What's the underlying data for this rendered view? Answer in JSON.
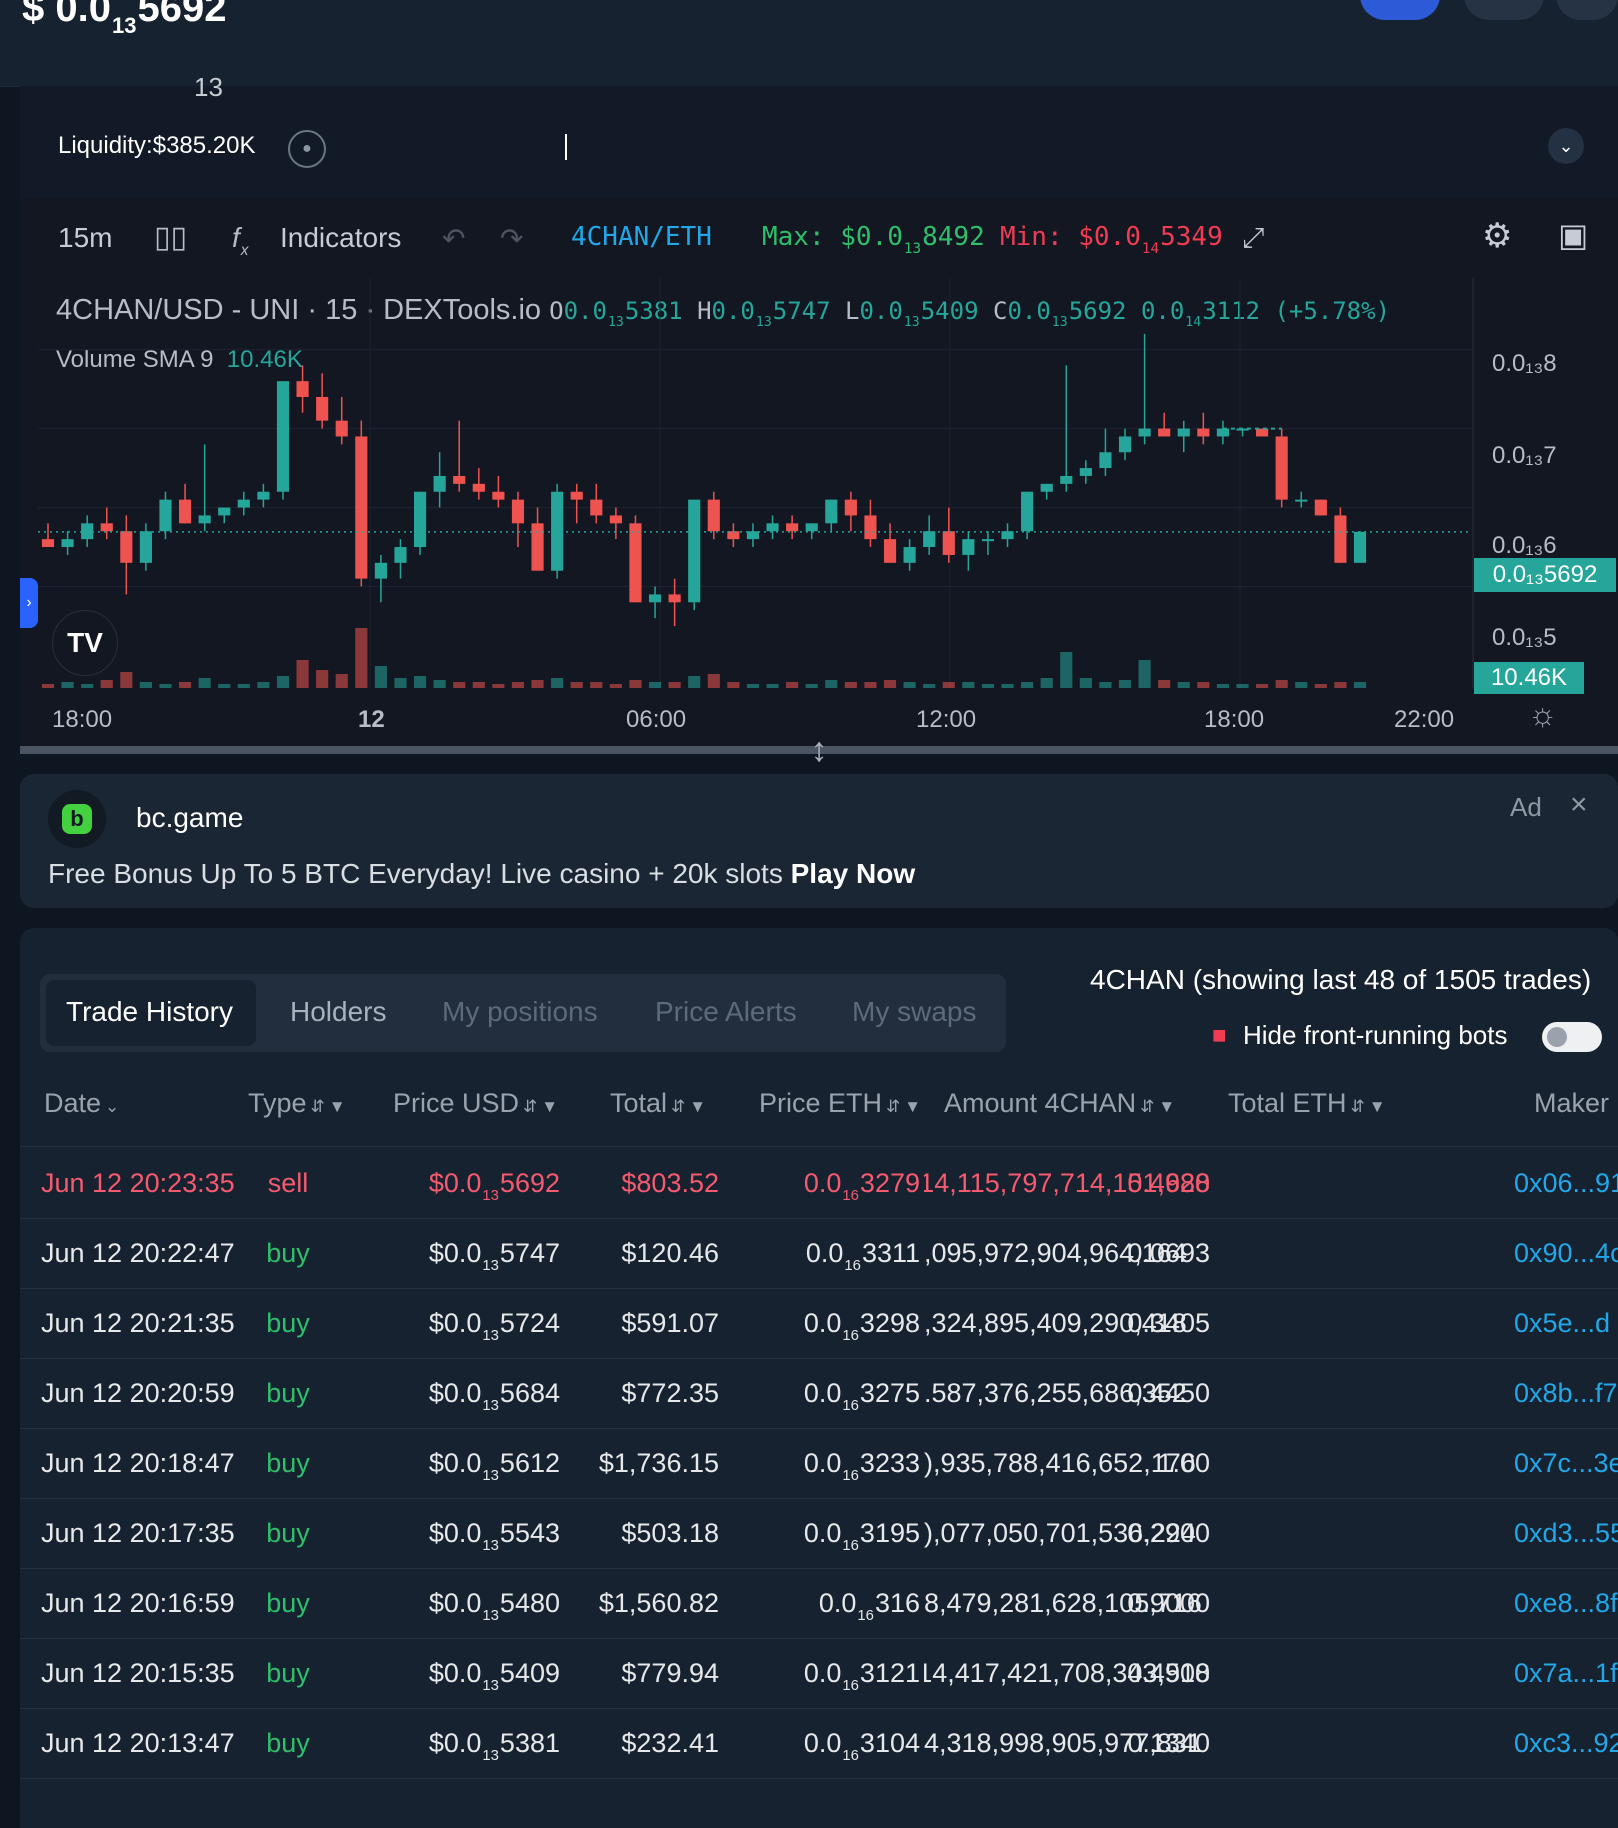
{
  "header": {
    "price_prefix": "$ 0.0",
    "price_sub": "13",
    "price_digits": "5692",
    "stray_sub": "13",
    "liquidity_label": "Liquidity:",
    "liquidity_value": "$385.20K"
  },
  "toolbar": {
    "interval": "15m",
    "indicators_label": "Indicators",
    "pair": "4CHAN/ETH",
    "max_label": "Max: $0.0",
    "max_sub": "13",
    "max_digits": "8492",
    "min_label": "Min: $0.0",
    "min_sub": "14",
    "min_digits": "5349"
  },
  "legend": {
    "symbol": "4CHAN/USD - UNI · 15 · DEXTools.io",
    "o_label": "O",
    "o_prefix": "0.0",
    "o_sub": "13",
    "o_digits": "5381",
    "h_label": "H",
    "h_prefix": "0.0",
    "h_sub": "13",
    "h_digits": "5747",
    "l_label": "L",
    "l_prefix": "0.0",
    "l_sub": "13",
    "l_digits": "5409",
    "c_label": "C",
    "c_prefix": "0.0",
    "c_sub": "13",
    "c_digits": "5692",
    "chg_prefix": "0.0",
    "chg_sub": "14",
    "chg_digits": "3112",
    "chg_pct": "(+5.78%)",
    "volume_label": "Volume SMA 9",
    "volume_value": "10.46K"
  },
  "chart_data": {
    "type": "candlestick",
    "title": "4CHAN/USD - UNI · 15 · DEXTools.io",
    "y_ticks": [
      "0.0₁₃8",
      "0.0₁₃7",
      "0.0₁₃6",
      "0.0₁₃5"
    ],
    "current_price_label": "0.0₁₃5692",
    "volume_label": "10.46K",
    "x_ticks": [
      "18:00",
      "12",
      "06:00",
      "12:00",
      "18:00",
      "22:00"
    ],
    "ylim": [
      0.45,
      0.84
    ],
    "y_unit": "×1e-13 USD",
    "current_price": 0.5692,
    "candles": [
      [
        0.56,
        0.58,
        0.55,
        0.55
      ],
      [
        0.55,
        0.57,
        0.54,
        0.56
      ],
      [
        0.56,
        0.59,
        0.55,
        0.58
      ],
      [
        0.58,
        0.6,
        0.56,
        0.57
      ],
      [
        0.57,
        0.59,
        0.49,
        0.53
      ],
      [
        0.53,
        0.58,
        0.52,
        0.57
      ],
      [
        0.57,
        0.62,
        0.56,
        0.61
      ],
      [
        0.61,
        0.63,
        0.58,
        0.58
      ],
      [
        0.58,
        0.68,
        0.57,
        0.59
      ],
      [
        0.59,
        0.6,
        0.58,
        0.6
      ],
      [
        0.6,
        0.62,
        0.59,
        0.61
      ],
      [
        0.61,
        0.63,
        0.6,
        0.62
      ],
      [
        0.62,
        0.76,
        0.61,
        0.76
      ],
      [
        0.76,
        0.78,
        0.72,
        0.74
      ],
      [
        0.74,
        0.77,
        0.7,
        0.71
      ],
      [
        0.71,
        0.74,
        0.68,
        0.69
      ],
      [
        0.69,
        0.71,
        0.5,
        0.51
      ],
      [
        0.51,
        0.54,
        0.48,
        0.53
      ],
      [
        0.53,
        0.56,
        0.51,
        0.55
      ],
      [
        0.55,
        0.62,
        0.54,
        0.62
      ],
      [
        0.62,
        0.67,
        0.6,
        0.64
      ],
      [
        0.64,
        0.71,
        0.62,
        0.63
      ],
      [
        0.63,
        0.65,
        0.61,
        0.62
      ],
      [
        0.62,
        0.64,
        0.6,
        0.61
      ],
      [
        0.61,
        0.62,
        0.55,
        0.58
      ],
      [
        0.58,
        0.6,
        0.54,
        0.52
      ],
      [
        0.52,
        0.63,
        0.51,
        0.62
      ],
      [
        0.62,
        0.63,
        0.58,
        0.61
      ],
      [
        0.61,
        0.63,
        0.58,
        0.59
      ],
      [
        0.59,
        0.6,
        0.56,
        0.58
      ],
      [
        0.58,
        0.59,
        0.52,
        0.48
      ],
      [
        0.48,
        0.5,
        0.46,
        0.49
      ],
      [
        0.49,
        0.51,
        0.45,
        0.48
      ],
      [
        0.48,
        0.6,
        0.47,
        0.61
      ],
      [
        0.61,
        0.62,
        0.56,
        0.57
      ],
      [
        0.57,
        0.58,
        0.55,
        0.56
      ],
      [
        0.56,
        0.58,
        0.55,
        0.57
      ],
      [
        0.57,
        0.59,
        0.56,
        0.58
      ],
      [
        0.58,
        0.59,
        0.56,
        0.57
      ],
      [
        0.57,
        0.58,
        0.56,
        0.58
      ],
      [
        0.58,
        0.61,
        0.57,
        0.61
      ],
      [
        0.61,
        0.62,
        0.57,
        0.59
      ],
      [
        0.59,
        0.61,
        0.55,
        0.56
      ],
      [
        0.56,
        0.58,
        0.54,
        0.53
      ],
      [
        0.53,
        0.56,
        0.52,
        0.55
      ],
      [
        0.55,
        0.59,
        0.54,
        0.57
      ],
      [
        0.57,
        0.6,
        0.53,
        0.54
      ],
      [
        0.54,
        0.57,
        0.52,
        0.56
      ],
      [
        0.56,
        0.57,
        0.54,
        0.56
      ],
      [
        0.56,
        0.58,
        0.55,
        0.57
      ],
      [
        0.57,
        0.62,
        0.56,
        0.62
      ],
      [
        0.62,
        0.63,
        0.61,
        0.63
      ],
      [
        0.63,
        0.78,
        0.62,
        0.64
      ],
      [
        0.64,
        0.66,
        0.63,
        0.65
      ],
      [
        0.65,
        0.7,
        0.64,
        0.67
      ],
      [
        0.67,
        0.7,
        0.66,
        0.69
      ],
      [
        0.69,
        0.82,
        0.68,
        0.7
      ],
      [
        0.7,
        0.72,
        0.69,
        0.69
      ],
      [
        0.69,
        0.71,
        0.67,
        0.7
      ],
      [
        0.7,
        0.72,
        0.68,
        0.69
      ],
      [
        0.69,
        0.71,
        0.68,
        0.7
      ],
      [
        0.7,
        0.7,
        0.69,
        0.7
      ],
      [
        0.7,
        0.7,
        0.69,
        0.69
      ],
      [
        0.69,
        0.7,
        0.6,
        0.61
      ],
      [
        0.61,
        0.62,
        0.6,
        0.61
      ],
      [
        0.61,
        0.61,
        0.59,
        0.59
      ],
      [
        0.59,
        0.6,
        0.53,
        0.53
      ],
      [
        0.53,
        0.57,
        0.53,
        0.5692
      ]
    ],
    "volumes": [
      2,
      3,
      2,
      4,
      8,
      3,
      2,
      3,
      5,
      2,
      2,
      3,
      6,
      14,
      9,
      7,
      30,
      11,
      5,
      6,
      4,
      3,
      3,
      2,
      3,
      4,
      5,
      3,
      3,
      2,
      4,
      3,
      3,
      6,
      7,
      3,
      2,
      2,
      3,
      2,
      4,
      3,
      3,
      4,
      3,
      2,
      3,
      3,
      2,
      2,
      3,
      5,
      18,
      5,
      3,
      4,
      14,
      4,
      3,
      3,
      2,
      2,
      2,
      4,
      3,
      2,
      3,
      3
    ]
  },
  "ad": {
    "name": "bc.game",
    "tag": "Ad",
    "logo_letter": "b",
    "text": "Free Bonus Up To 5 BTC Everyday! Live casino + 20k slots",
    "cta": "Play Now"
  },
  "trades": {
    "tabs": [
      "Trade History",
      "Holders",
      "My positions",
      "Price Alerts",
      "My swaps"
    ],
    "summary": "4CHAN (showing last 48 of 1505 trades)",
    "hide_bots_label": "Hide front-running bots",
    "columns": [
      "Date",
      "Type",
      "Price USD",
      "Total",
      "Price ETH",
      "Amount 4CHAN",
      "Total ETH",
      "Maker"
    ],
    "rows": [
      {
        "date": "Jun 12 20:23:35",
        "type": "sell",
        "usd_prefix": "$0.0",
        "usd_sub": "13",
        "usd_digits": "5692",
        "total": "$803.52",
        "eth_prefix": "0.0",
        "eth_sub": "16",
        "eth_digits": "3279",
        "amount": "14,115,797,714,151,980",
        "total_eth": "0.4628",
        "maker": "0x06...91"
      },
      {
        "date": "Jun 12 20:22:47",
        "type": "buy",
        "usd_prefix": "$0.0",
        "usd_sub": "13",
        "usd_digits": "5747",
        "total": "$120.46",
        "eth_prefix": "0.0",
        "eth_sub": "16",
        "eth_digits": "3311",
        "amount": ",095,972,904,964,164",
        "total_eth": "0.0693",
        "maker": "0x90...4c"
      },
      {
        "date": "Jun 12 20:21:35",
        "type": "buy",
        "usd_prefix": "$0.0",
        "usd_sub": "13",
        "usd_digits": "5724",
        "total": "$591.07",
        "eth_prefix": "0.0",
        "eth_sub": "16",
        "eth_digits": "3298",
        "amount": ",324,895,409,290,418",
        "total_eth": "0.3405",
        "maker": "0x5e...d"
      },
      {
        "date": "Jun 12 20:20:59",
        "type": "buy",
        "usd_prefix": "$0.0",
        "usd_sub": "13",
        "usd_digits": "5684",
        "total": "$772.35",
        "eth_prefix": "0.0",
        "eth_sub": "16",
        "eth_digits": "3275",
        "amount": ".587,376,255,686,352",
        "total_eth": "0.4450",
        "maker": "0x8b...f7"
      },
      {
        "date": "Jun 12 20:18:47",
        "type": "buy",
        "usd_prefix": "$0.0",
        "usd_sub": "13",
        "usd_digits": "5612",
        "total": "$1,736.15",
        "eth_prefix": "0.0",
        "eth_sub": "16",
        "eth_digits": "3233",
        "amount": "),935,788,416,652,176",
        "total_eth": "1.00",
        "maker": "0x7c...3e"
      },
      {
        "date": "Jun 12 20:17:35",
        "type": "buy",
        "usd_prefix": "$0.0",
        "usd_sub": "13",
        "usd_digits": "5543",
        "total": "$503.18",
        "eth_prefix": "0.0",
        "eth_sub": "16",
        "eth_digits": "3195",
        "amount": "),077,050,701,536,224",
        "total_eth": "0.2900",
        "maker": "0xd3...55"
      },
      {
        "date": "Jun 12 20:16:59",
        "type": "buy",
        "usd_prefix": "$0.0",
        "usd_sub": "13",
        "usd_digits": "5480",
        "total": "$1,560.82",
        "eth_prefix": "0.0",
        "eth_sub": "16",
        "eth_digits": "316",
        "amount": "8,479,281,628,105,716",
        "total_eth": "0.9000",
        "maker": "0xe8...8f"
      },
      {
        "date": "Jun 12 20:15:35",
        "type": "buy",
        "usd_prefix": "$0.0",
        "usd_sub": "13",
        "usd_digits": "5409",
        "total": "$779.94",
        "eth_prefix": "0.0",
        "eth_sub": "16",
        "eth_digits": "3121",
        "amount": "14,417,421,708,343,918",
        "total_eth": "0.4500",
        "maker": "0x7a...1f"
      },
      {
        "date": "Jun 12 20:13:47",
        "type": "buy",
        "usd_prefix": "$0.0",
        "usd_sub": "13",
        "usd_digits": "5381",
        "total": "$232.41",
        "eth_prefix": "0.0",
        "eth_sub": "16",
        "eth_digits": "3104",
        "amount": "4,318,998,905,977,831",
        "total_eth": "0.1340",
        "maker": "0xc3...92"
      }
    ]
  },
  "colors": {
    "up": "#26a69a",
    "down": "#ef5350",
    "accent": "#22a7e8",
    "buy": "#2fbf6a",
    "sell": "#f55a6e"
  },
  "icons": [
    "lock-icon",
    "chevron-down-icon",
    "candle-style-icon",
    "fx-icon",
    "undo-icon",
    "redo-icon",
    "fullscreen-icon",
    "gear-icon",
    "camera-icon",
    "close-icon",
    "bot-icon",
    "sort-icon",
    "filter-icon"
  ]
}
